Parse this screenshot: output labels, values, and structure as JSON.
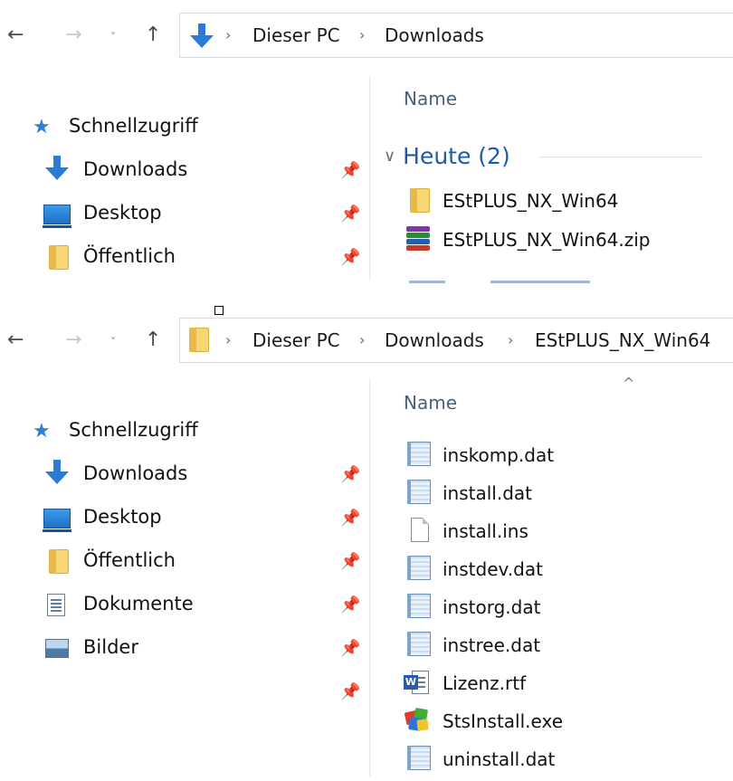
{
  "window1": {
    "nav": {
      "back": "←",
      "forward": "→",
      "recent": "˅",
      "up": "↑"
    },
    "breadcrumb": [
      "Dieser PC",
      "Downloads"
    ],
    "sidebar": {
      "quick_access": "Schnellzugriff",
      "items": [
        {
          "label": "Downloads",
          "icon": "downloads-icon",
          "pinned": true
        },
        {
          "label": "Desktop",
          "icon": "desktop-icon",
          "pinned": true
        },
        {
          "label": "Öffentlich",
          "icon": "folder-icon",
          "pinned": true
        }
      ]
    },
    "column_header": "Name",
    "group": {
      "label": "Heute (2)",
      "chevron": "∨"
    },
    "files": [
      {
        "name": "EStPLUS_NX_Win64",
        "icon": "folder-icon"
      },
      {
        "name": "EStPLUS_NX_Win64.zip",
        "icon": "winrar-archive-icon"
      }
    ]
  },
  "window2": {
    "nav": {
      "back": "←",
      "forward": "→",
      "recent": "˅",
      "up": "↑"
    },
    "breadcrumb": [
      "Dieser PC",
      "Downloads",
      "EStPLUS_NX_Win64"
    ],
    "sidebar": {
      "quick_access": "Schnellzugriff",
      "items": [
        {
          "label": "Downloads",
          "icon": "downloads-icon",
          "pinned": true
        },
        {
          "label": "Desktop",
          "icon": "desktop-icon",
          "pinned": true
        },
        {
          "label": "Öffentlich",
          "icon": "folder-icon",
          "pinned": true
        },
        {
          "label": "Dokumente",
          "icon": "documents-icon",
          "pinned": true
        },
        {
          "label": "Bilder",
          "icon": "pictures-icon",
          "pinned": true
        }
      ]
    },
    "column_header": "Name",
    "sort_indicator": "^",
    "files": [
      {
        "name": "inskomp.dat",
        "icon": "dat-file-icon"
      },
      {
        "name": "install.dat",
        "icon": "dat-file-icon"
      },
      {
        "name": "install.ins",
        "icon": "blank-file-icon"
      },
      {
        "name": "instdev.dat",
        "icon": "dat-file-icon"
      },
      {
        "name": "instorg.dat",
        "icon": "dat-file-icon"
      },
      {
        "name": "instree.dat",
        "icon": "dat-file-icon"
      },
      {
        "name": "Lizenz.rtf",
        "icon": "word-document-icon"
      },
      {
        "name": "StsInstall.exe",
        "icon": "installer-exe-icon"
      },
      {
        "name": "uninstall.dat",
        "icon": "dat-file-icon"
      }
    ]
  },
  "colors": {
    "accent": "#1e5aa8",
    "column_header": "#4c607a",
    "folder": "#f7d774",
    "download_arrow": "#2b7bd6"
  }
}
